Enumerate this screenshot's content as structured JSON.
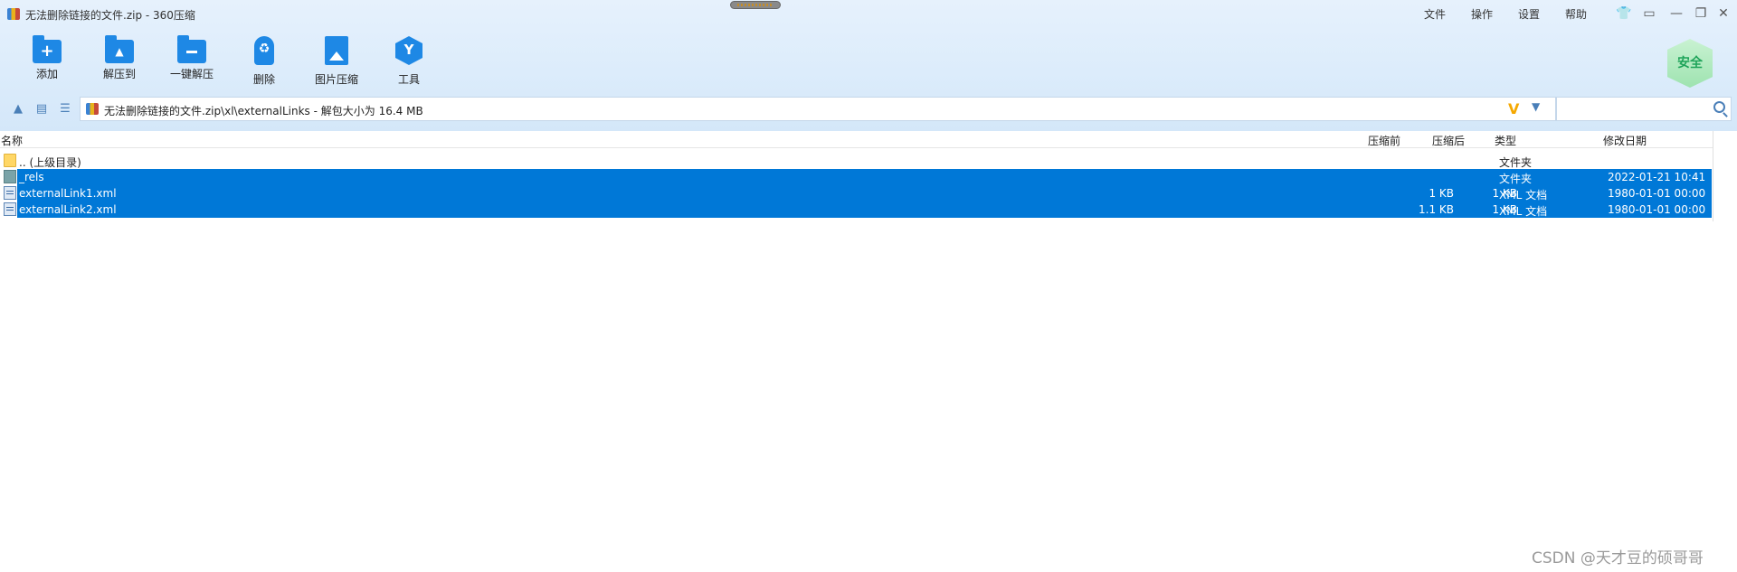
{
  "window": {
    "title": "无法删除链接的文件.zip - 360压缩",
    "menus": [
      "文件",
      "操作",
      "设置",
      "帮助"
    ]
  },
  "toolbar": {
    "add": "添加",
    "extract_to": "解压到",
    "one_click_extract": "一键解压",
    "delete": "删除",
    "image_compress": "图片压缩",
    "tools": "工具"
  },
  "safe_badge": "安全",
  "address": {
    "path": "无法删除链接的文件.zip\\xl\\externalLinks - 解包大小为 16.4 MB",
    "v_mark": "V"
  },
  "search": {
    "placeholder": ""
  },
  "columns": {
    "name": "名称",
    "before": "压缩前",
    "after": "压缩后",
    "type": "类型",
    "modified": "修改日期"
  },
  "rows": [
    {
      "name": ".. (上级目录)",
      "before": "",
      "after": "",
      "type": "文件夹",
      "modified": "",
      "icon": "folder-yellow-icon",
      "selected": false
    },
    {
      "name": "_rels",
      "before": "",
      "after": "",
      "type": "文件夹",
      "modified": "2022-01-21 10:41",
      "icon": "folder-icon",
      "selected": true
    },
    {
      "name": "externalLink1.xml",
      "before": "1 KB",
      "after": "1 KB",
      "type": "XML 文档",
      "modified": "1980-01-01 00:00",
      "icon": "xml-file-icon",
      "selected": true
    },
    {
      "name": "externalLink2.xml",
      "before": "1.1 KB",
      "after": "1 KB",
      "type": "XML 文档",
      "modified": "1980-01-01 00:00",
      "icon": "xml-file-icon",
      "selected": true
    }
  ],
  "watermark": "CSDN @天才豆的硕哥哥",
  "colors": {
    "selection": "#0078d7",
    "accent": "#1e88e5"
  }
}
